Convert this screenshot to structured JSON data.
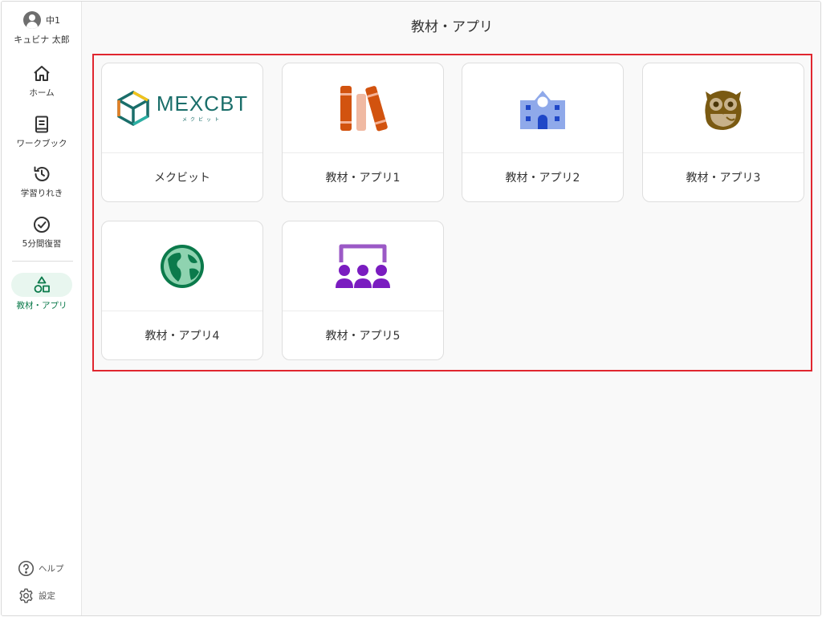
{
  "user": {
    "grade": "中1",
    "name": "キュビナ 太郎"
  },
  "sidebar": {
    "items": [
      {
        "label": "ホーム",
        "icon": "home-icon"
      },
      {
        "label": "ワークブック",
        "icon": "book-icon"
      },
      {
        "label": "学習りれき",
        "icon": "history-icon"
      },
      {
        "label": "5分間復習",
        "icon": "check-circle-icon"
      },
      {
        "label": "教材・アプリ",
        "icon": "shapes-icon",
        "active": true
      }
    ],
    "help_label": "ヘルプ",
    "settings_label": "設定"
  },
  "main": {
    "title": "教材・アプリ",
    "cards": [
      {
        "label": "メクビット",
        "icon": "mexcbt-logo",
        "logo_text": "MEXCBT",
        "logo_sub": "メクビット"
      },
      {
        "label": "教材・アプリ1",
        "icon": "books-icon"
      },
      {
        "label": "教材・アプリ2",
        "icon": "school-icon"
      },
      {
        "label": "教材・アプリ3",
        "icon": "owl-icon"
      },
      {
        "label": "教材・アプリ4",
        "icon": "globe-icon"
      },
      {
        "label": "教材・アプリ5",
        "icon": "classroom-icon"
      }
    ]
  },
  "colors": {
    "accent": "#0b7a4b",
    "accent_bg": "#e8f6ef",
    "highlight_border": "#e0262f",
    "mexcbt_teal": "#1a6e6a",
    "books_orange": "#d2530f",
    "school_blue": "#7b9be6",
    "owl_brown": "#7a5a12",
    "globe_green": "#0b7a4b",
    "classroom_purple": "#7a1cc0"
  }
}
